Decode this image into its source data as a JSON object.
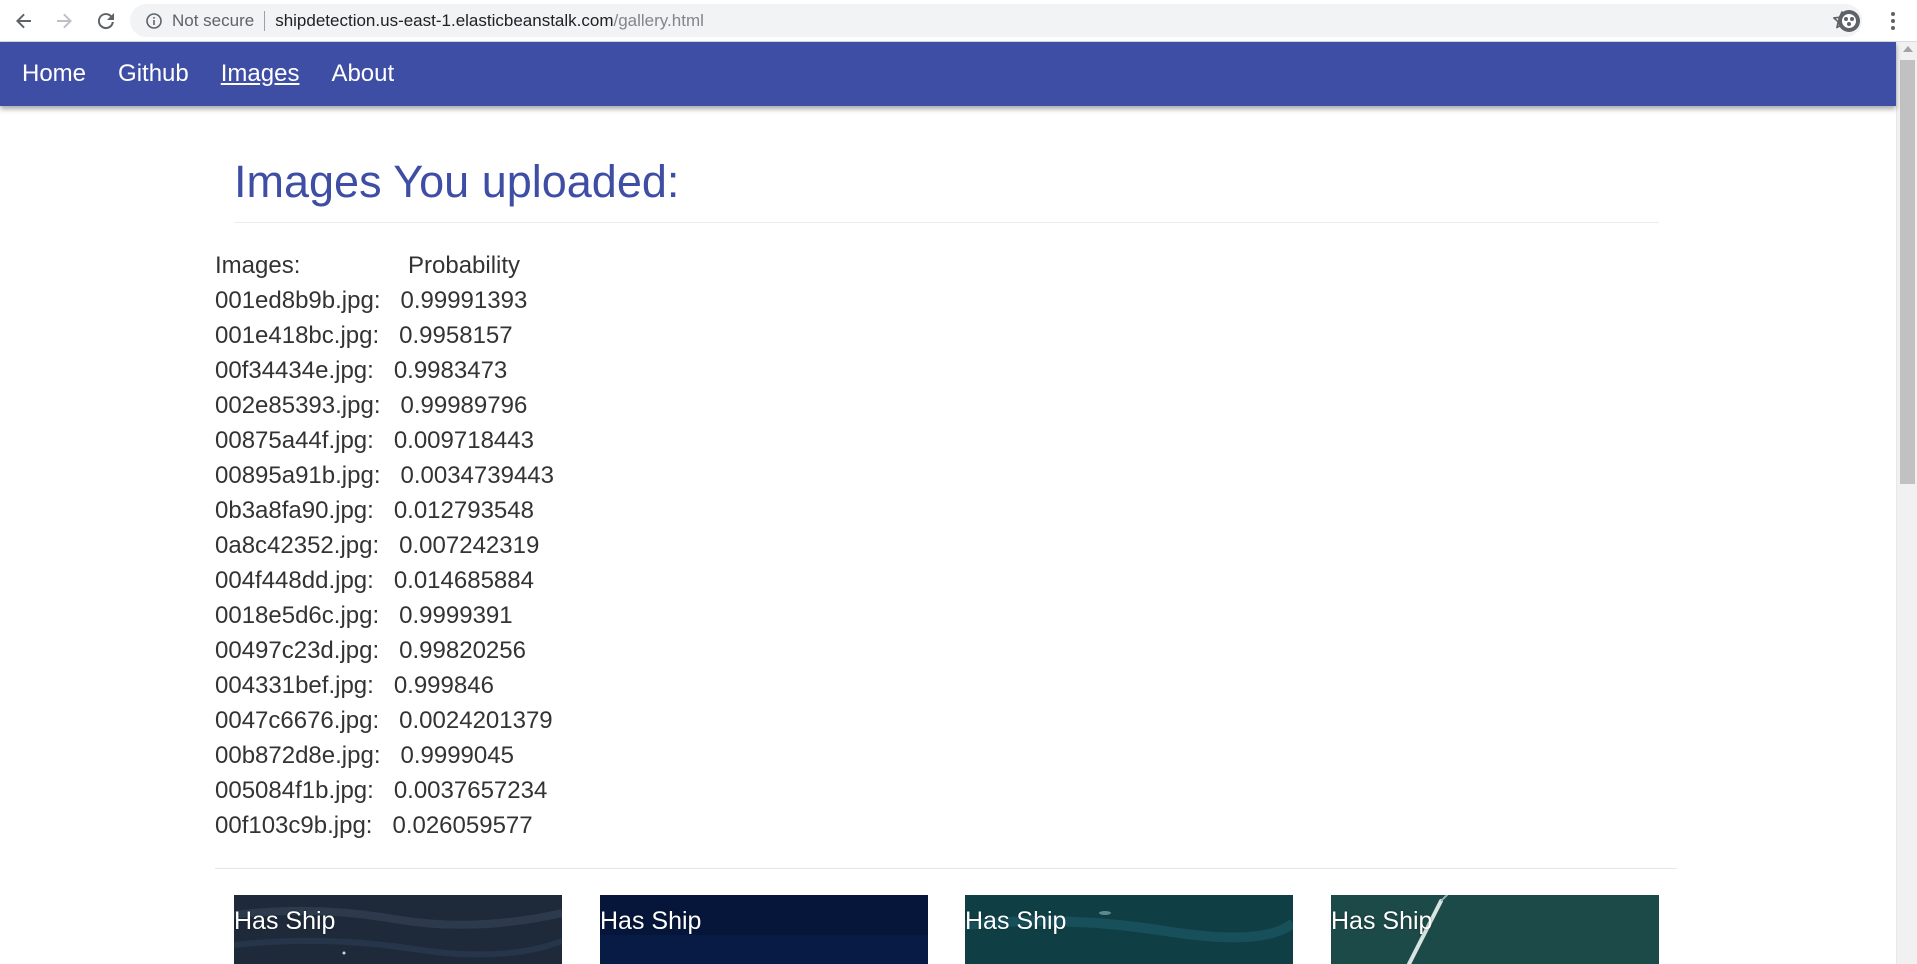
{
  "browser": {
    "security_label": "Not secure",
    "url_host": "shipdetection.us-east-1.elasticbeanstalk.com",
    "url_path": "/gallery.html",
    "icons": [
      "back-arrow-icon",
      "forward-arrow-icon",
      "reload-icon",
      "info-icon",
      "star-icon",
      "extension-icon",
      "menu-icon"
    ]
  },
  "nav": {
    "items": [
      {
        "label": "Home",
        "active": false
      },
      {
        "label": "Github",
        "active": false
      },
      {
        "label": "Images",
        "active": true
      },
      {
        "label": "About",
        "active": false
      }
    ],
    "color": "#3f4ea5"
  },
  "main": {
    "title": "Images You uploaded:",
    "table_headers": {
      "name": "Images:",
      "probability": "Probability"
    },
    "rows": [
      {
        "name": "001ed8b9b.jpg:",
        "probability": "0.99991393"
      },
      {
        "name": "001e418bc.jpg:",
        "probability": "0.9958157"
      },
      {
        "name": "00f34434e.jpg:",
        "probability": "0.9983473"
      },
      {
        "name": "002e85393.jpg:",
        "probability": "0.99989796"
      },
      {
        "name": "00875a44f.jpg:",
        "probability": "0.009718443"
      },
      {
        "name": "00895a91b.jpg:",
        "probability": "0.0034739443"
      },
      {
        "name": "0b3a8fa90.jpg:",
        "probability": "0.012793548"
      },
      {
        "name": "0a8c42352.jpg:",
        "probability": "0.007242319"
      },
      {
        "name": "004f448dd.jpg:",
        "probability": "0.014685884"
      },
      {
        "name": "0018e5d6c.jpg:",
        "probability": "0.9999391"
      },
      {
        "name": "00497c23d.jpg:",
        "probability": "0.99820256"
      },
      {
        "name": "004331bef.jpg:",
        "probability": "0.999846"
      },
      {
        "name": "0047c6676.jpg:",
        "probability": "0.0024201379"
      },
      {
        "name": "00b872d8e.jpg:",
        "probability": "0.9999045"
      },
      {
        "name": "005084f1b.jpg:",
        "probability": "0.0037657234"
      },
      {
        "name": "00f103c9b.jpg:",
        "probability": "0.026059577"
      }
    ]
  },
  "gallery": {
    "cards": [
      {
        "label": "Has Ship",
        "color": "#1e2a3a"
      },
      {
        "label": "Has Ship",
        "color": "#06163a"
      },
      {
        "label": "Has Ship",
        "color": "#0f3f44"
      },
      {
        "label": "Has Ship",
        "color": "#1c4a48"
      }
    ]
  }
}
